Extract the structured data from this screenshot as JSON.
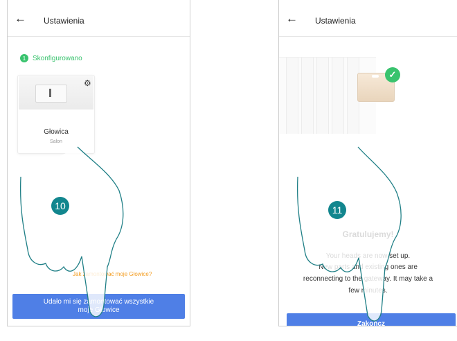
{
  "left": {
    "header": {
      "back_icon": "←",
      "title": "Ustawienia"
    },
    "status": {
      "number": "1",
      "label": "Skonfigurowano"
    },
    "device_card": {
      "name": "Głowica",
      "room": "Salon"
    },
    "help_link": "Jak zamontować moje Głowice?",
    "primary_button": "Udało mi się zamontować wszystkie moje Głowice",
    "step_badge": "10"
  },
  "right": {
    "header": {
      "back_icon": "←",
      "title": "Ustawienia"
    },
    "congrats": "Gratulujemy!",
    "message_lines": [
      "Your heads are now set up.",
      "New parts and existing ones are",
      "reconnecting to the gateway. It may take a",
      "few minutes."
    ],
    "primary_button": "Zakończ",
    "step_badge": "11"
  },
  "colors": {
    "accent_green": "#39c36e",
    "button_blue": "#4f7fe6",
    "link_orange": "#f39c1f",
    "badge_teal": "#12868e"
  }
}
